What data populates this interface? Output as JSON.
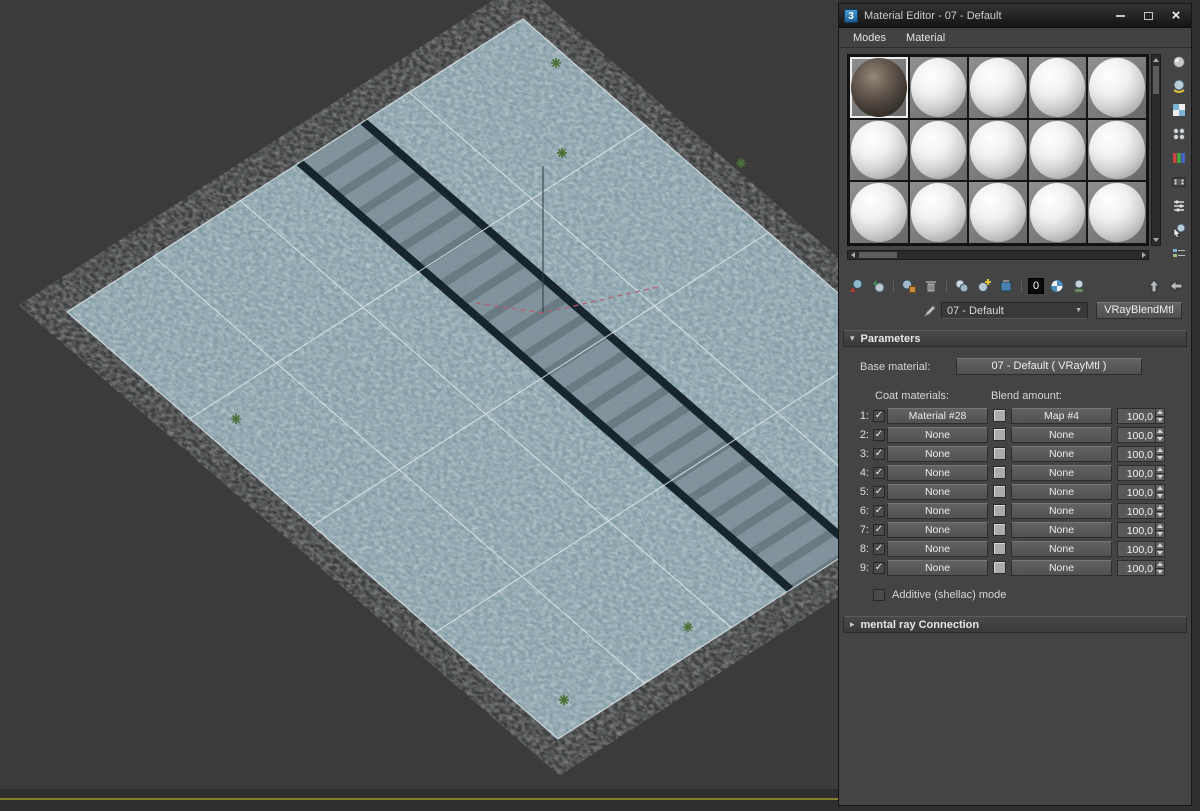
{
  "window": {
    "title": "Material Editor - 07 - Default",
    "logo_glyph": "3",
    "menus": [
      "Modes",
      "Material"
    ],
    "close_glyph": "×"
  },
  "sample_slots": {
    "rows": 3,
    "cols": 5,
    "selected_slot": 1
  },
  "toolbar": {
    "material_id_label": "0"
  },
  "name_row": {
    "material_name": "07 - Default",
    "dropdown_arrow": "▼",
    "material_type": "VRayBlendMtl"
  },
  "parameters": {
    "header": "Parameters",
    "expand_glyph": "▾",
    "base_material_label": "Base material:",
    "base_material_value": "07 - Default  ( VRayMtl )",
    "coat_materials_label": "Coat materials:",
    "blend_amount_label": "Blend amount:",
    "check_glyph": "✓",
    "rows": [
      {
        "n": "1:",
        "checked": true,
        "material": "Material #28",
        "map": "Map #4",
        "amount": "100,0"
      },
      {
        "n": "2:",
        "checked": true,
        "material": "None",
        "map": "None",
        "amount": "100,0"
      },
      {
        "n": "3:",
        "checked": true,
        "material": "None",
        "map": "None",
        "amount": "100,0"
      },
      {
        "n": "4:",
        "checked": true,
        "material": "None",
        "map": "None",
        "amount": "100,0"
      },
      {
        "n": "5:",
        "checked": true,
        "material": "None",
        "map": "None",
        "amount": "100,0"
      },
      {
        "n": "6:",
        "checked": true,
        "material": "None",
        "map": "None",
        "amount": "100,0"
      },
      {
        "n": "7:",
        "checked": true,
        "material": "None",
        "map": "None",
        "amount": "100,0"
      },
      {
        "n": "8:",
        "checked": true,
        "material": "None",
        "map": "None",
        "amount": "100,0"
      },
      {
        "n": "9:",
        "checked": true,
        "material": "None",
        "map": "None",
        "amount": "100,0"
      }
    ],
    "additive_label": "Additive (shellac) mode"
  },
  "mental_ray": {
    "header": "mental ray Connection",
    "collapse_glyph": "▸"
  },
  "viewport": {
    "colors": {
      "background": "#3b3b3b",
      "texture_base": "#8da6b0",
      "rail": "#17262e",
      "grid_line": "#e3ebee",
      "tie_light": "#7e9099",
      "tie_dark": "#64757e",
      "plant": "#4b7038",
      "selection_path": "#b95f72",
      "timeline_line": "#7e7e2c"
    }
  }
}
